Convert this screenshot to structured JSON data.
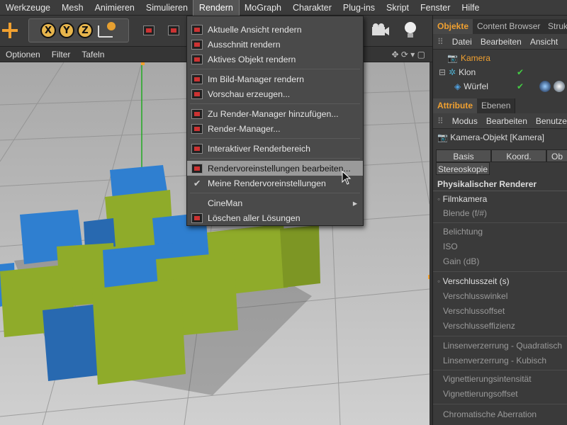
{
  "menubar": {
    "items": [
      "Werkzeuge",
      "Mesh",
      "Animieren",
      "Simulieren",
      "Rendern",
      "MoGraph",
      "Charakter",
      "Plug-ins",
      "Skript",
      "Fenster",
      "Hilfe"
    ],
    "active": "Rendern"
  },
  "toolbar": {
    "axis_x": "X",
    "axis_y": "Y",
    "axis_z": "Z"
  },
  "viewport_menu": [
    "Optionen",
    "Filter",
    "Tafeln"
  ],
  "dropdown": {
    "items": [
      {
        "label": "Aktuelle Ansicht rendern",
        "icon": "render-view-icon"
      },
      {
        "label": "Ausschnitt rendern",
        "icon": "render-region-icon"
      },
      {
        "label": "Aktives Objekt rendern",
        "icon": "render-active-object-icon"
      },
      {
        "label": "Im Bild-Manager rendern",
        "icon": "picture-viewer-icon"
      },
      {
        "label": "Vorschau erzeugen...",
        "icon": "preview-icon"
      },
      {
        "label": "Zu Render-Manager hinzufügen...",
        "icon": "add-render-queue-icon"
      },
      {
        "label": "Render-Manager...",
        "icon": "render-queue-icon"
      },
      {
        "label": "Interaktiver Renderbereich",
        "icon": "interactive-render-icon"
      },
      {
        "label": "Rendervoreinstellungen bearbeiten...",
        "icon": "render-settings-icon"
      },
      {
        "label": "Meine Rendervoreinstellungen",
        "icon": "checkmark-icon"
      },
      {
        "label": "CineMan",
        "icon": "",
        "submenu": "▸"
      },
      {
        "label": "Löschen aller Lösungen",
        "icon": "delete-icon"
      }
    ]
  },
  "objects_panel": {
    "tabs": [
      "Objekte",
      "Content Browser",
      "Struk"
    ],
    "menu": [
      "Datei",
      "Bearbeiten",
      "Ansicht"
    ],
    "rows": [
      {
        "name": "Kamera"
      },
      {
        "name": "Klon"
      },
      {
        "name": "Würfel"
      }
    ]
  },
  "attributes_panel": {
    "tabs": [
      "Attribute",
      "Ebenen"
    ],
    "menu": [
      "Modus",
      "Bearbeiten",
      "Benutze"
    ],
    "object_title": "Kamera-Objekt [Kamera]",
    "buttons": [
      "Basis",
      "Koord.",
      "Ob"
    ],
    "stereo": "Stereoskopie",
    "section": "Physikalischer Renderer",
    "group1": "Filmkamera",
    "fields1": [
      "Blende (f/#)"
    ],
    "fields2": [
      "Belichtung",
      "ISO",
      "Gain (dB)"
    ],
    "group2": "Verschlusszeit (s)",
    "fields3": [
      "Verschlusswinkel",
      "Verschlussoffset",
      "Verschlusseffizienz"
    ],
    "fields4": [
      "Linsenverzerrung - Quadratisch",
      "Linsenverzerrung - Kubisch"
    ],
    "fields5": [
      "Vignettierungsintensität",
      "Vignettierungsoffset"
    ],
    "fields6": [
      "Chromatische Aberration"
    ]
  },
  "colors": {
    "accent": "#f0a030",
    "cube_blue": "#2f7fd0",
    "cube_green": "#8fab2a"
  }
}
